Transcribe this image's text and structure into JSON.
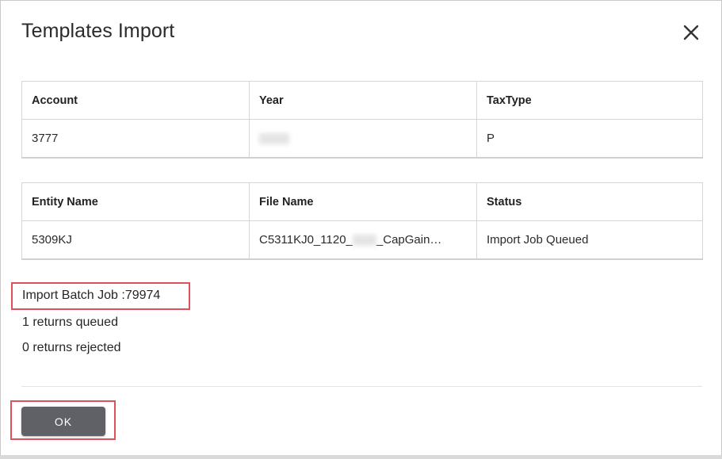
{
  "dialog": {
    "title": "Templates Import",
    "close_icon": "close-icon"
  },
  "account_table": {
    "headers": [
      "Account",
      "Year",
      "TaxType"
    ],
    "row": [
      "3777",
      "",
      "P"
    ]
  },
  "file_table": {
    "headers": [
      "Entity Name",
      "File Name",
      "Status"
    ],
    "row": {
      "entity": "5309KJ",
      "file_prefix": "C5311KJ0_1120_",
      "file_suffix": "_CapGain…",
      "status": "Import Job Queued"
    }
  },
  "summary": {
    "batch_job": "Import Batch Job :79974",
    "queued": "1 returns queued",
    "rejected": "0 returns rejected"
  },
  "footer": {
    "ok_label": "OK"
  },
  "colors": {
    "highlight": "#e0505a",
    "ok_button": "#5f6166"
  }
}
